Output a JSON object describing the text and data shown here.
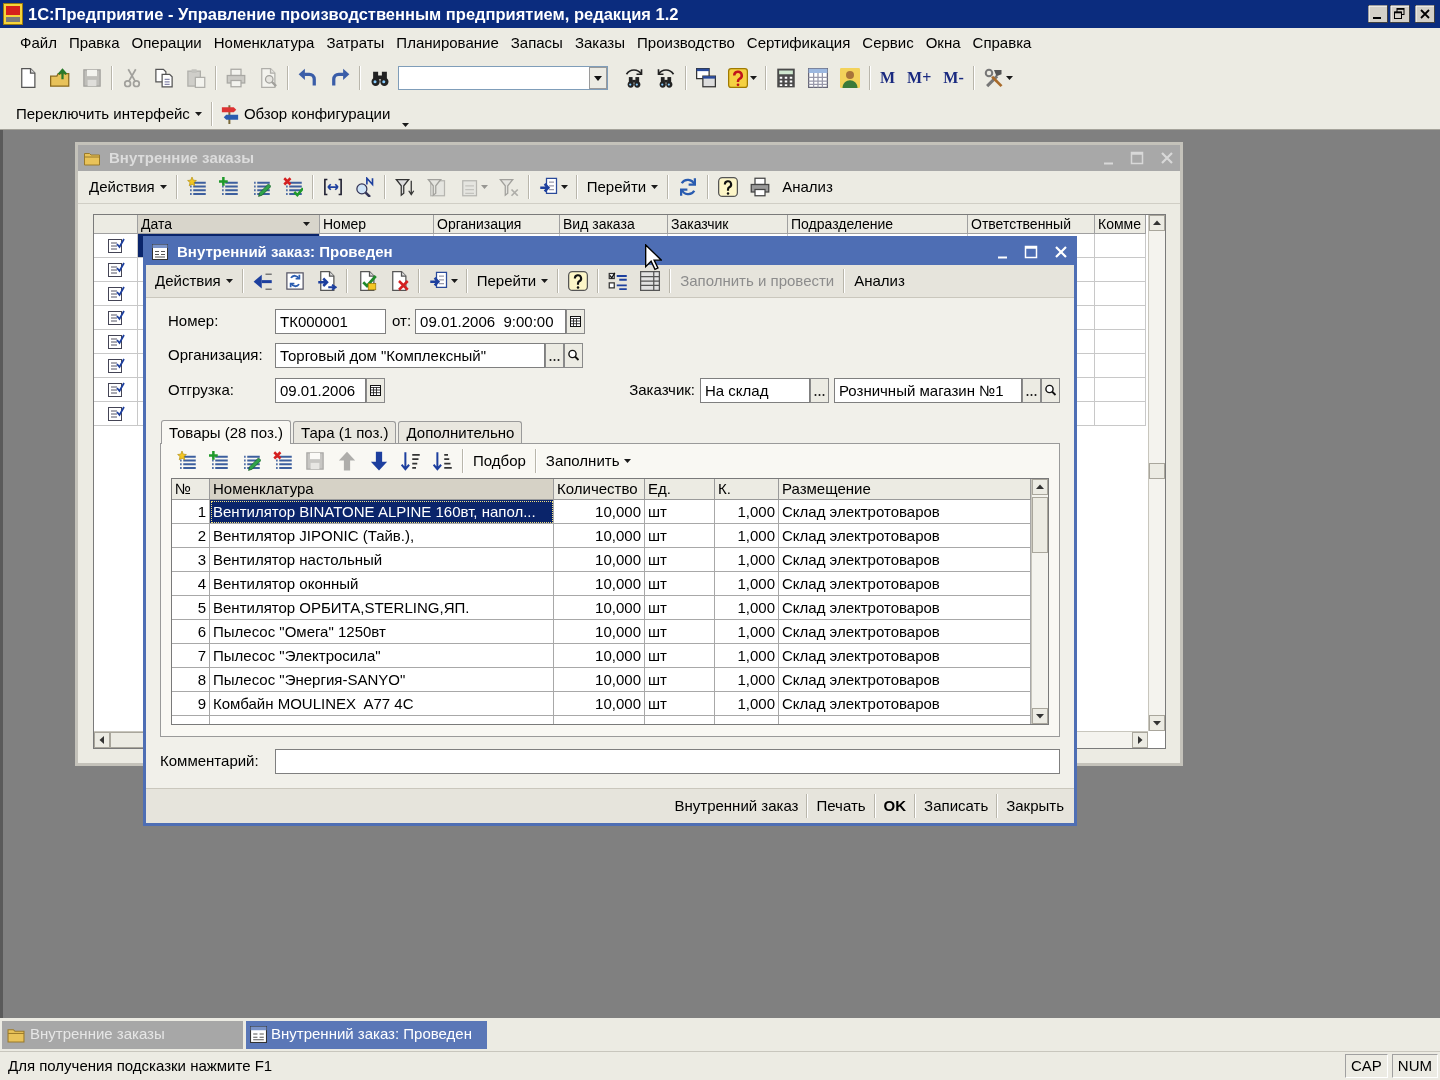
{
  "app": {
    "title": "1С:Предприятие - Управление производственным предприятием, редакция 1.2"
  },
  "menu": [
    "Файл",
    "Правка",
    "Операции",
    "Номенклатура",
    "Затраты",
    "Планирование",
    "Запасы",
    "Заказы",
    "Производство",
    "Сертификация",
    "Сервис",
    "Окна",
    "Справка"
  ],
  "toolbar": [
    {
      "kind": "icon",
      "disabled": false
    },
    {
      "kind": "icon",
      "disabled": false
    },
    {
      "kind": "icon",
      "disabled": true
    },
    {
      "kind": "separator"
    },
    {
      "kind": "icon",
      "disabled": true
    },
    {
      "kind": "icon",
      "disabled": false
    },
    {
      "kind": "icon",
      "disabled": true
    },
    {
      "kind": "separator"
    },
    {
      "kind": "icon",
      "disabled": true
    },
    {
      "kind": "icon",
      "disabled": true
    },
    {
      "kind": "separator"
    },
    {
      "kind": "icon",
      "disabled": false
    },
    {
      "kind": "icon",
      "disabled": false
    },
    {
      "kind": "separator"
    },
    {
      "kind": "icon",
      "disabled": false
    },
    {
      "kind": "combo",
      "disabled": false
    },
    {
      "kind": "icon",
      "disabled": false
    },
    {
      "kind": "icon",
      "disabled": false
    },
    {
      "kind": "separator"
    },
    {
      "kind": "icon",
      "disabled": false
    },
    {
      "kind": "icon_menu",
      "disabled": false
    },
    {
      "kind": "separator"
    },
    {
      "kind": "icon",
      "disabled": false
    },
    {
      "kind": "icon",
      "disabled": false
    },
    {
      "kind": "icon",
      "disabled": false
    },
    {
      "kind": "separator"
    },
    {
      "kind": "memory",
      "label": "M",
      "disabled": false
    },
    {
      "kind": "memory",
      "label": "M+",
      "disabled": false
    },
    {
      "kind": "memory",
      "label": "M-",
      "disabled": false
    },
    {
      "kind": "separator"
    },
    {
      "kind": "icon_menu",
      "disabled": false
    }
  ],
  "toolbar_2": [
    {
      "kind": "text_menu",
      "label": "Переключить интерфейс",
      "disabled": false
    },
    {
      "kind": "separator"
    },
    {
      "kind": "icon_text",
      "label": "Обзор конфигурации",
      "disabled": false
    },
    {
      "kind": "overflow"
    }
  ],
  "orders_window": {
    "title": "Внутренние заказы",
    "active": false,
    "toolbar": [
      {
        "kind": "text_menu",
        "label": "Действия",
        "disabled": false
      },
      {
        "kind": "separator"
      },
      {
        "kind": "icon",
        "disabled": false
      },
      {
        "kind": "icon",
        "disabled": false
      },
      {
        "kind": "icon",
        "disabled": false
      },
      {
        "kind": "icon",
        "disabled": false
      },
      {
        "kind": "separator"
      },
      {
        "kind": "icon",
        "disabled": false
      },
      {
        "kind": "icon",
        "disabled": false
      },
      {
        "kind": "separator"
      },
      {
        "kind": "icon",
        "disabled": false
      },
      {
        "kind": "icon",
        "disabled": true
      },
      {
        "kind": "icon_menu",
        "disabled": true
      },
      {
        "kind": "icon",
        "disabled": true
      },
      {
        "kind": "separator"
      },
      {
        "kind": "icon_menu",
        "disabled": false
      },
      {
        "kind": "separator"
      },
      {
        "kind": "text_menu",
        "label": "Перейти",
        "disabled": false
      },
      {
        "kind": "separator"
      },
      {
        "kind": "icon",
        "disabled": false
      },
      {
        "kind": "separator"
      },
      {
        "kind": "icon",
        "disabled": false
      },
      {
        "kind": "icon",
        "disabled": false
      },
      {
        "kind": "text",
        "label": "Анализ",
        "disabled": false
      }
    ],
    "columns": [
      {
        "label": "Дата",
        "sorted": true
      },
      {
        "label": "Номер",
        "sorted": false
      },
      {
        "label": "Организация",
        "sorted": false
      },
      {
        "label": "Вид заказа",
        "sorted": false
      },
      {
        "label": "Заказчик",
        "sorted": false
      },
      {
        "label": "Подразделение",
        "sorted": false
      },
      {
        "label": "Ответственный",
        "sorted": false
      },
      {
        "label": "Комме",
        "sorted": false
      }
    ],
    "rows": [
      {
        "selected": true
      },
      {
        "selected": false
      },
      {
        "selected": false
      },
      {
        "selected": false
      },
      {
        "selected": false
      },
      {
        "selected": false
      },
      {
        "selected": false
      },
      {
        "selected": false
      }
    ]
  },
  "order_dialog": {
    "title": "Внутренний заказ: Проведен",
    "active": true,
    "toolbar": [
      {
        "kind": "text_menu",
        "label": "Действия",
        "disabled": false
      },
      {
        "kind": "separator"
      },
      {
        "kind": "icon",
        "disabled": false
      },
      {
        "kind": "icon",
        "disabled": false
      },
      {
        "kind": "icon",
        "disabled": false
      },
      {
        "kind": "separator"
      },
      {
        "kind": "icon",
        "disabled": false
      },
      {
        "kind": "icon",
        "disabled": false
      },
      {
        "kind": "separator"
      },
      {
        "kind": "icon_menu",
        "disabled": false
      },
      {
        "kind": "separator"
      },
      {
        "kind": "text_menu",
        "label": "Перейти",
        "disabled": false
      },
      {
        "kind": "separator"
      },
      {
        "kind": "icon",
        "disabled": false
      },
      {
        "kind": "separator"
      },
      {
        "kind": "icon",
        "disabled": false
      },
      {
        "kind": "icon",
        "disabled": false
      },
      {
        "kind": "separator"
      },
      {
        "kind": "text",
        "label": "Заполнить и провести",
        "disabled": true
      },
      {
        "kind": "separator"
      },
      {
        "kind": "text",
        "label": "Анализ",
        "disabled": false
      }
    ],
    "number": {
      "label": "Номер:",
      "value": "ТК000001"
    },
    "date": {
      "label": "от:",
      "value": "09.01.2006  9:00:00"
    },
    "organization": {
      "label": "Организация:",
      "value": "Торговый дом \"Комплексный\""
    },
    "shipment": {
      "label": "Отгрузка:",
      "value": "09.01.2006"
    },
    "customer": {
      "label": "Заказчик:",
      "values": [
        "На склад",
        "Розничный магазин №1"
      ]
    },
    "tabs": [
      {
        "label": "Товары (28 поз.)",
        "selected": true
      },
      {
        "label": "Тара (1 поз.)",
        "selected": false
      },
      {
        "label": "Дополнительно",
        "selected": false
      }
    ],
    "table_toolbar": [
      {
        "kind": "icon",
        "disabled": false
      },
      {
        "kind": "icon",
        "disabled": false
      },
      {
        "kind": "icon",
        "disabled": false
      },
      {
        "kind": "icon",
        "disabled": false
      },
      {
        "kind": "icon",
        "disabled": true
      },
      {
        "kind": "icon",
        "disabled": true
      },
      {
        "kind": "icon",
        "disabled": false
      },
      {
        "kind": "icon",
        "disabled": false
      },
      {
        "kind": "icon",
        "disabled": false
      },
      {
        "kind": "separator"
      },
      {
        "kind": "text",
        "label": "Подбор",
        "disabled": false
      },
      {
        "kind": "separator"
      },
      {
        "kind": "text_menu",
        "label": "Заполнить",
        "disabled": false
      }
    ],
    "table": {
      "columns": [
        {
          "label": "№",
          "highlighted": false
        },
        {
          "label": "Номенклатура",
          "highlighted": true
        },
        {
          "label": "Количество",
          "highlighted": false
        },
        {
          "label": "Ед.",
          "highlighted": false
        },
        {
          "label": "К.",
          "highlighted": false
        },
        {
          "label": "Размещение",
          "highlighted": false
        }
      ],
      "rows": [
        {
          "number": "1",
          "name": "Вентилятор BINATONE ALPINE 160вт, напол...",
          "quantity": "10,000",
          "unit": "шт",
          "k": "1,000",
          "location": "Склад электротоваров",
          "selected": true
        },
        {
          "number": "2",
          "name": "Вентилятор JIPONIC (Тайв.),",
          "quantity": "10,000",
          "unit": "шт",
          "k": "1,000",
          "location": "Склад электротоваров",
          "selected": false
        },
        {
          "number": "3",
          "name": "Вентилятор настольный",
          "quantity": "10,000",
          "unit": "шт",
          "k": "1,000",
          "location": "Склад электротоваров",
          "selected": false
        },
        {
          "number": "4",
          "name": "Вентилятор оконный",
          "quantity": "10,000",
          "unit": "шт",
          "k": "1,000",
          "location": "Склад электротоваров",
          "selected": false
        },
        {
          "number": "5",
          "name": "Вентилятор ОРБИТА,STERLING,ЯП.",
          "quantity": "10,000",
          "unit": "шт",
          "k": "1,000",
          "location": "Склад электротоваров",
          "selected": false
        },
        {
          "number": "6",
          "name": "Пылесос \"Омега\" 1250вт",
          "quantity": "10,000",
          "unit": "шт",
          "k": "1,000",
          "location": "Склад электротоваров",
          "selected": false
        },
        {
          "number": "7",
          "name": "Пылесос \"Электросила\"",
          "quantity": "10,000",
          "unit": "шт",
          "k": "1,000",
          "location": "Склад электротоваров",
          "selected": false
        },
        {
          "number": "8",
          "name": "Пылесос \"Энергия-SANYO\"",
          "quantity": "10,000",
          "unit": "шт",
          "k": "1,000",
          "location": "Склад электротоваров",
          "selected": false
        },
        {
          "number": "9",
          "name": "Комбайн MOULINEX  A77 4C",
          "quantity": "10,000",
          "unit": "шт",
          "k": "1,000",
          "location": "Склад электротоваров",
          "selected": false
        }
      ]
    },
    "comment": {
      "label": "Комментарий:"
    },
    "buttons": [
      {
        "label": "Внутренний заказ",
        "default": false
      },
      {
        "label": "Печать",
        "default": false
      },
      {
        "label": "OK",
        "default": true
      },
      {
        "label": "Записать",
        "default": false
      },
      {
        "label": "Закрыть",
        "default": false
      }
    ]
  },
  "taskbar": [
    {
      "kind": "list",
      "label": "Внутренние заказы",
      "selected": false
    },
    {
      "kind": "document",
      "label": "Внутренний заказ: Проведен",
      "selected": true
    }
  ],
  "status_bar": {
    "hint": "Для получения подсказки нажмите F1",
    "indicators": [
      "CAP",
      "NUM"
    ]
  }
}
